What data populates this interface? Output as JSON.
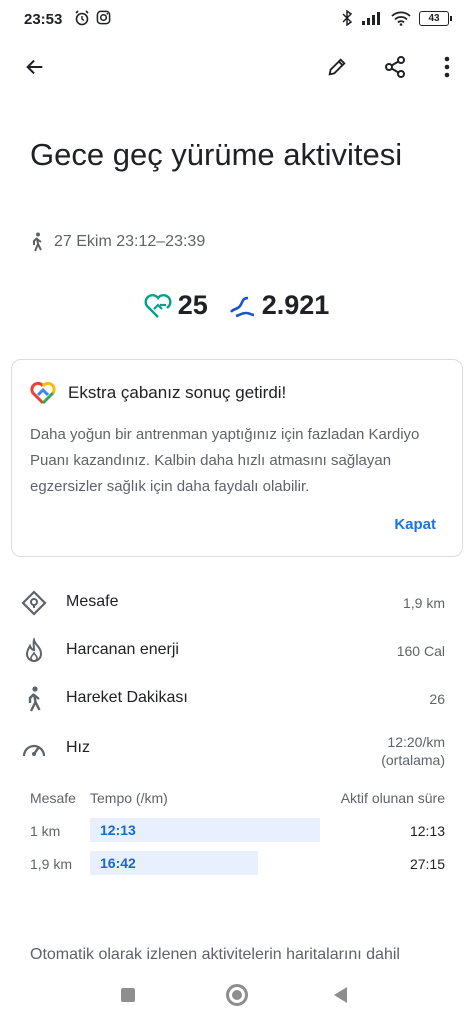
{
  "status_bar": {
    "time": "23:53",
    "battery": "43"
  },
  "title": "Gece geç yürüme aktivitesi",
  "meta": "27 Ekim 23:12–23:39",
  "stats": {
    "heart_points": "25",
    "steps": "2.921"
  },
  "card": {
    "heading": "Ekstra çabanız sonuç getirdi!",
    "body": "Daha yoğun bir antrenman yaptığınız için fazladan Kardiyo Puanı kazandınız. Kalbin daha hızlı atmasını sağlayan egzersizler sağlık için daha faydalı olabilir.",
    "close_label": "Kapat"
  },
  "metrics": [
    {
      "label": "Mesafe",
      "value": "1,9 km",
      "icon": "location-diamond-icon"
    },
    {
      "label": "Harcanan enerji",
      "value": "160 Cal",
      "icon": "flame-icon"
    },
    {
      "label": "Hareket Dakikası",
      "value": "26",
      "icon": "walking-icon"
    },
    {
      "label": "Hız",
      "value": "12:20/km",
      "value_sub": "(ortalama)",
      "icon": "speedometer-icon"
    }
  ],
  "pace": {
    "headers": [
      "Mesafe",
      "Tempo (/km)",
      "Aktif olunan süre"
    ],
    "rows": [
      {
        "distance": "1 km",
        "pace": "12:13",
        "active_time": "12:13",
        "bar_fraction": 1.0
      },
      {
        "distance": "1,9 km",
        "pace": "16:42",
        "active_time": "27:15",
        "bar_fraction": 0.73
      }
    ]
  },
  "footer": "Otomatik olarak izlenen aktivitelerin haritalarını dahil",
  "colors": {
    "accent_blue": "#1a73e8",
    "heart_teal": "#00a389",
    "steps_blue": "#1a56c9",
    "bar_bg": "#e8f0fe"
  }
}
